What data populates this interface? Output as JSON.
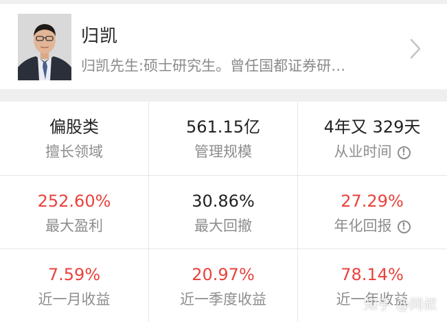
{
  "manager": {
    "name": "归凯",
    "bio": "归凯先生:硕士研究生。曾任国都证券研…"
  },
  "stats": [
    {
      "value": "偏股类",
      "label": "擅长领域",
      "color": "dark",
      "info": false
    },
    {
      "value": "561.15亿",
      "label": "管理规模",
      "color": "dark",
      "info": false
    },
    {
      "value": "4年又 329天",
      "label": "从业时间",
      "color": "dark",
      "info": true
    },
    {
      "value": "252.60%",
      "label": "最大盈利",
      "color": "red",
      "info": false
    },
    {
      "value": "30.86%",
      "label": "最大回撤",
      "color": "dark",
      "info": false
    },
    {
      "value": "27.29%",
      "label": "年化回报",
      "color": "red",
      "info": true
    },
    {
      "value": "7.59%",
      "label": "近一月收益",
      "color": "red",
      "info": false
    },
    {
      "value": "20.97%",
      "label": "近一季度收益",
      "color": "red",
      "info": false
    },
    {
      "value": "78.14%",
      "label": "近一年收益",
      "color": "red",
      "info": false
    }
  ],
  "info_icon_glyph": "!",
  "watermark": "知乎 @网叔",
  "colors": {
    "red": "#e8423c",
    "dark": "#222222",
    "muted": "#8d8d8d"
  }
}
